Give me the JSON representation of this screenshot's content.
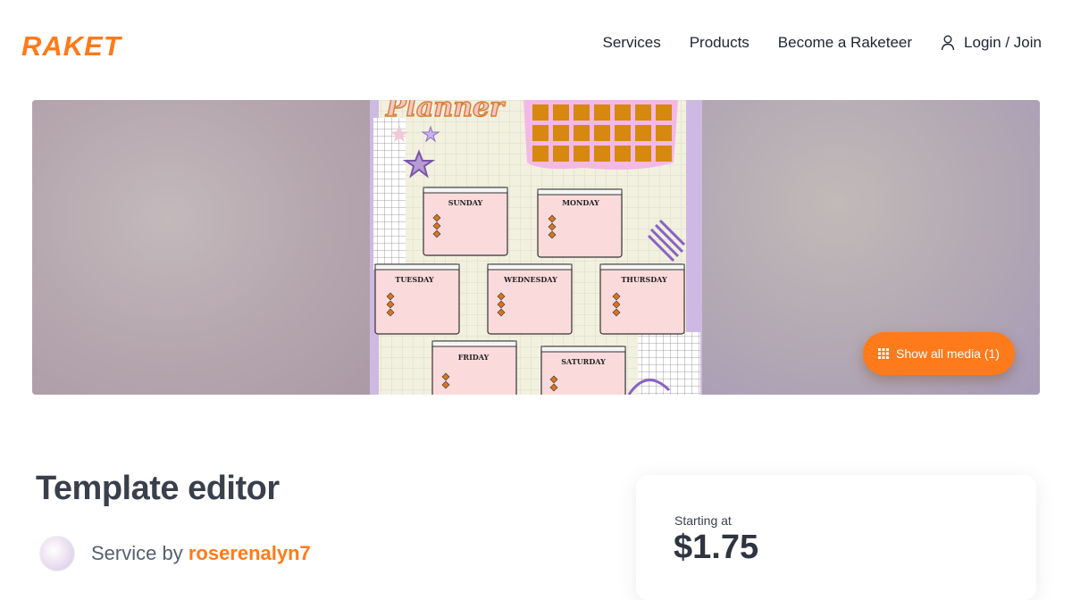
{
  "brand": {
    "logo_text": "RAKET",
    "accent": "#ff7a1a"
  },
  "nav": {
    "items": [
      {
        "label": "Services"
      },
      {
        "label": "Products"
      },
      {
        "label": "Become a Raketeer"
      }
    ],
    "login_label": "Login / Join",
    "login_icon": "user-icon"
  },
  "hero": {
    "image_text": {
      "heading": "Planner",
      "days": [
        "SUNDAY",
        "MONDAY",
        "TUESDAY",
        "WEDNESDAY",
        "THURSDAY",
        "FRIDAY",
        "SATURDAY"
      ]
    },
    "show_media_label": "Show all media (1)",
    "show_media_icon": "grid-icon"
  },
  "service": {
    "title": "Template editor",
    "by_prefix": "Service by ",
    "seller": "roserenalyn7"
  },
  "pricing": {
    "starting_label": "Starting at",
    "price": "$1.75"
  }
}
